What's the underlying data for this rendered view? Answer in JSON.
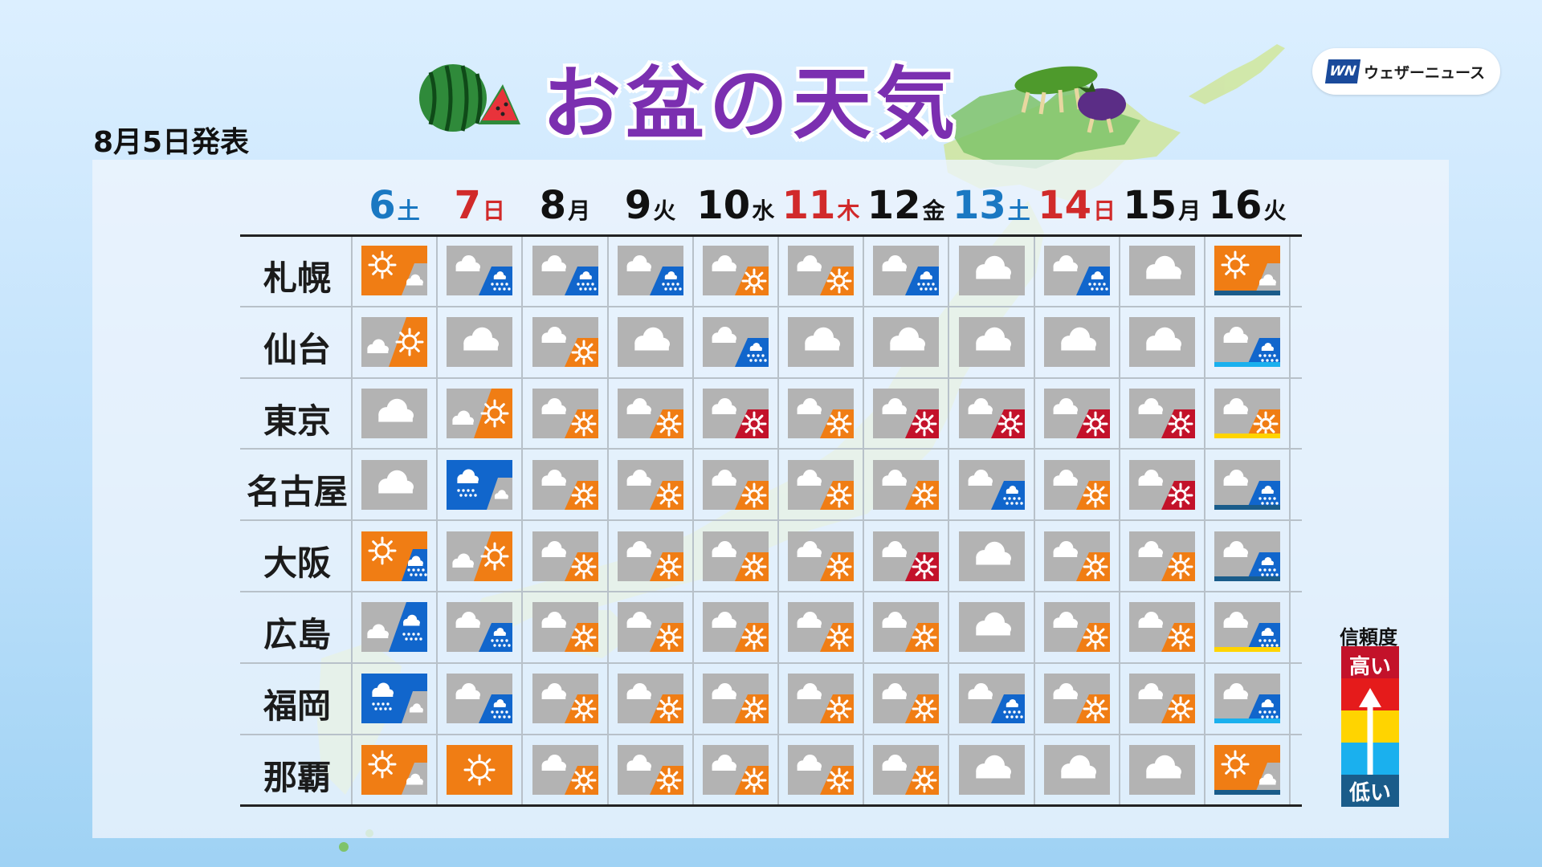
{
  "header": {
    "title": "お盆の天気",
    "issued": "8月5日発表",
    "brand": "ウェザーニュース",
    "brand_mark": "WN"
  },
  "colors": {
    "sun": "#f07d14",
    "rain": "#1166cc",
    "cloud_bg": "#b3b3b3",
    "strong_sun": "#c3122a",
    "saturday": "#1a78c2",
    "sunday": "#d12a2a",
    "weekday": "#111111"
  },
  "days": [
    {
      "num": "6",
      "wd": "土",
      "kind": "sat"
    },
    {
      "num": "7",
      "wd": "日",
      "kind": "sun"
    },
    {
      "num": "8",
      "wd": "月",
      "kind": "wk"
    },
    {
      "num": "9",
      "wd": "火",
      "kind": "wk"
    },
    {
      "num": "10",
      "wd": "水",
      "kind": "wk"
    },
    {
      "num": "11",
      "wd": "木",
      "kind": "sun"
    },
    {
      "num": "12",
      "wd": "金",
      "kind": "wk"
    },
    {
      "num": "13",
      "wd": "土",
      "kind": "sat"
    },
    {
      "num": "14",
      "wd": "日",
      "kind": "sun"
    },
    {
      "num": "15",
      "wd": "月",
      "kind": "wk"
    },
    {
      "num": "16",
      "wd": "火",
      "kind": "wk"
    }
  ],
  "cities": [
    {
      "name": "札幌",
      "forecast": [
        "sunny-then-cloudy",
        "cloudy-then-rain",
        "cloudy-then-rain",
        "cloudy-then-rain",
        "cloudy-then-sunny",
        "cloudy-then-sunny",
        "cloudy-then-rain",
        "cloudy",
        "cloudy-then-rain",
        "cloudy",
        "sunny-then-cloudy"
      ],
      "last_reliability": "low"
    },
    {
      "name": "仙台",
      "forecast": [
        "cloudy-then-sunny-orange",
        "cloudy",
        "cloudy-then-sunny",
        "cloudy",
        "cloudy-then-rain",
        "cloudy",
        "cloudy",
        "cloudy",
        "cloudy",
        "cloudy",
        "cloudy-then-rain"
      ],
      "last_reliability": "mid-low"
    },
    {
      "name": "東京",
      "forecast": [
        "cloudy",
        "cloudy-then-sunny-orange",
        "cloudy-then-sunny",
        "cloudy-then-sunny",
        "cloudy-then-hot",
        "cloudy-then-sunny",
        "cloudy-then-hot",
        "cloudy-then-hot",
        "cloudy-then-hot",
        "cloudy-then-hot",
        "cloudy-then-sunny"
      ],
      "last_reliability": "mid"
    },
    {
      "name": "名古屋",
      "forecast": [
        "cloudy",
        "rain-then-cloudy",
        "cloudy-then-sunny",
        "cloudy-then-sunny",
        "cloudy-then-sunny",
        "cloudy-then-sunny",
        "cloudy-then-sunny",
        "cloudy-then-rain",
        "cloudy-then-sunny",
        "cloudy-then-hot",
        "cloudy-then-rain"
      ],
      "last_reliability": "low"
    },
    {
      "name": "大阪",
      "forecast": [
        "sunny-then-rain",
        "cloudy-then-sunny-orange",
        "cloudy-then-sunny",
        "cloudy-then-sunny",
        "cloudy-then-sunny",
        "cloudy-then-sunny",
        "cloudy-then-hot",
        "cloudy",
        "cloudy-then-sunny",
        "cloudy-then-sunny",
        "cloudy-then-rain"
      ],
      "last_reliability": "low"
    },
    {
      "name": "広島",
      "forecast": [
        "cloudy-then-rain-blue",
        "cloudy-then-rain",
        "cloudy-then-sunny",
        "cloudy-then-sunny",
        "cloudy-then-sunny",
        "cloudy-then-sunny",
        "cloudy-then-sunny",
        "cloudy",
        "cloudy-then-sunny",
        "cloudy-then-sunny",
        "cloudy-then-rain"
      ],
      "last_reliability": "mid"
    },
    {
      "name": "福岡",
      "forecast": [
        "rain-then-cloudy",
        "cloudy-then-rain",
        "cloudy-then-sunny",
        "cloudy-then-sunny",
        "cloudy-then-sunny",
        "cloudy-then-sunny",
        "cloudy-then-sunny",
        "cloudy-then-rain",
        "cloudy-then-sunny",
        "cloudy-then-sunny",
        "cloudy-then-rain"
      ],
      "last_reliability": "mid-low"
    },
    {
      "name": "那覇",
      "forecast": [
        "sunny-then-cloudy",
        "sunny",
        "cloudy-then-sunny",
        "cloudy-then-sunny",
        "cloudy-then-sunny",
        "cloudy-then-sunny",
        "cloudy-then-sunny",
        "cloudy",
        "cloudy",
        "cloudy",
        "sunny-then-cloudy"
      ],
      "last_reliability": "low"
    }
  ],
  "legend": {
    "title": "信頼度",
    "high": "高い",
    "low": "低い",
    "colors": [
      "#c3122a",
      "#e51b1b",
      "#ffd400",
      "#1ab0ee",
      "#1a5c8a"
    ]
  }
}
